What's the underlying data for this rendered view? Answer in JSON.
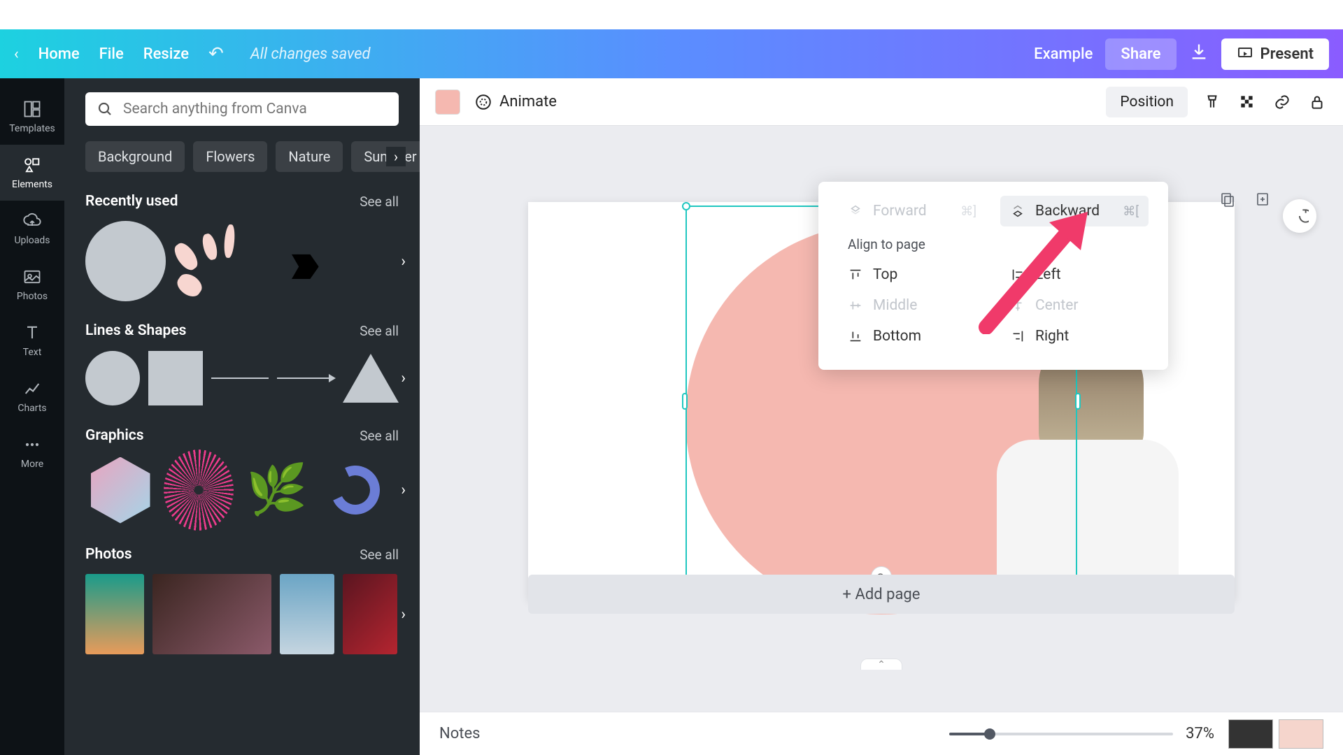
{
  "menubar": {
    "home": "Home",
    "file": "File",
    "resize": "Resize",
    "saved": "All changes saved",
    "example": "Example",
    "share": "Share",
    "present": "Present"
  },
  "rail": {
    "templates": "Templates",
    "elements": "Elements",
    "uploads": "Uploads",
    "photos": "Photos",
    "text": "Text",
    "charts": "Charts",
    "more": "More"
  },
  "panel": {
    "search_placeholder": "Search anything from Canva",
    "chips": [
      "Background",
      "Flowers",
      "Nature",
      "Summer"
    ],
    "see_all": "See all",
    "sections": {
      "recent": "Recently used",
      "lines": "Lines & Shapes",
      "graphics": "Graphics",
      "photos": "Photos"
    }
  },
  "toolbar": {
    "animate": "Animate",
    "position": "Position",
    "swatch_color": "#f5b8b0"
  },
  "position_menu": {
    "forward": "Forward",
    "forward_kb": "⌘]",
    "backward": "Backward",
    "backward_kb": "⌘[",
    "align_label": "Align to page",
    "top": "Top",
    "left": "Left",
    "middle": "Middle",
    "center": "Center",
    "bottom": "Bottom",
    "right": "Right"
  },
  "canvas": {
    "add_page": "+ Add page"
  },
  "footer": {
    "notes": "Notes",
    "zoom": "37%"
  }
}
